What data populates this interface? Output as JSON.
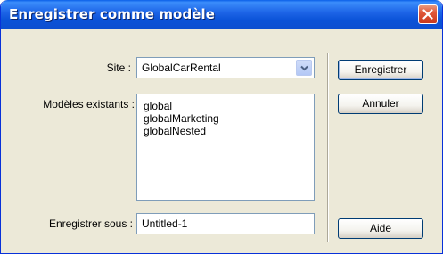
{
  "window": {
    "title": "Enregistrer comme modèle"
  },
  "form": {
    "site_label": "Site :",
    "site_value": "GlobalCarRental",
    "templates_label": "Modèles existants :",
    "templates": [
      "global",
      "globalMarketing",
      "globalNested"
    ],
    "save_as_label": "Enregistrer sous :",
    "save_as_value": "Untitled-1"
  },
  "buttons": {
    "save": "Enregistrer",
    "cancel": "Annuler",
    "help": "Aide"
  },
  "icons": {
    "close": "close-icon",
    "dropdown": "chevron-down-icon"
  },
  "colors": {
    "titlebar": "#0b53d8",
    "close_button": "#e0573a",
    "dialog_background": "#ece9d8",
    "field_border": "#7f9db9"
  }
}
